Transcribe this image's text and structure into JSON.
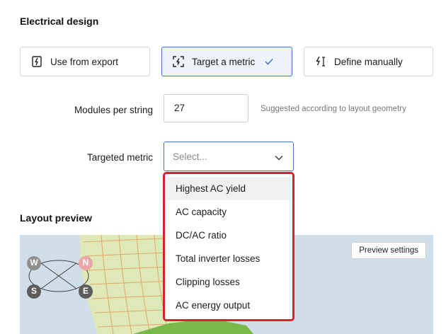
{
  "sections": {
    "electrical_design": "Electrical design",
    "layout_preview": "Layout preview"
  },
  "modes": [
    {
      "label": "Use from export",
      "icon": "export-file-icon",
      "active": false
    },
    {
      "label": "Target a metric",
      "icon": "target-metric-icon",
      "active": true
    },
    {
      "label": "Define manually",
      "icon": "define-manually-icon",
      "active": false
    }
  ],
  "modules_per_string": {
    "label": "Modules per string",
    "value": "27",
    "hint": "Suggested according to layout geometry"
  },
  "targeted_metric": {
    "label": "Targeted metric",
    "placeholder": "Select...",
    "options": [
      "Highest AC yield",
      "AC capacity",
      "DC/AC ratio",
      "Total inverter losses",
      "Clipping losses",
      "AC energy output"
    ]
  },
  "preview": {
    "settings_label": "Preview settings",
    "compass": {
      "w": "W",
      "n": "N",
      "s": "S",
      "e": "E"
    }
  },
  "colors": {
    "accent": "#3c73c4",
    "highlight_border": "#d6232f",
    "map_bg": "#d0deea"
  }
}
